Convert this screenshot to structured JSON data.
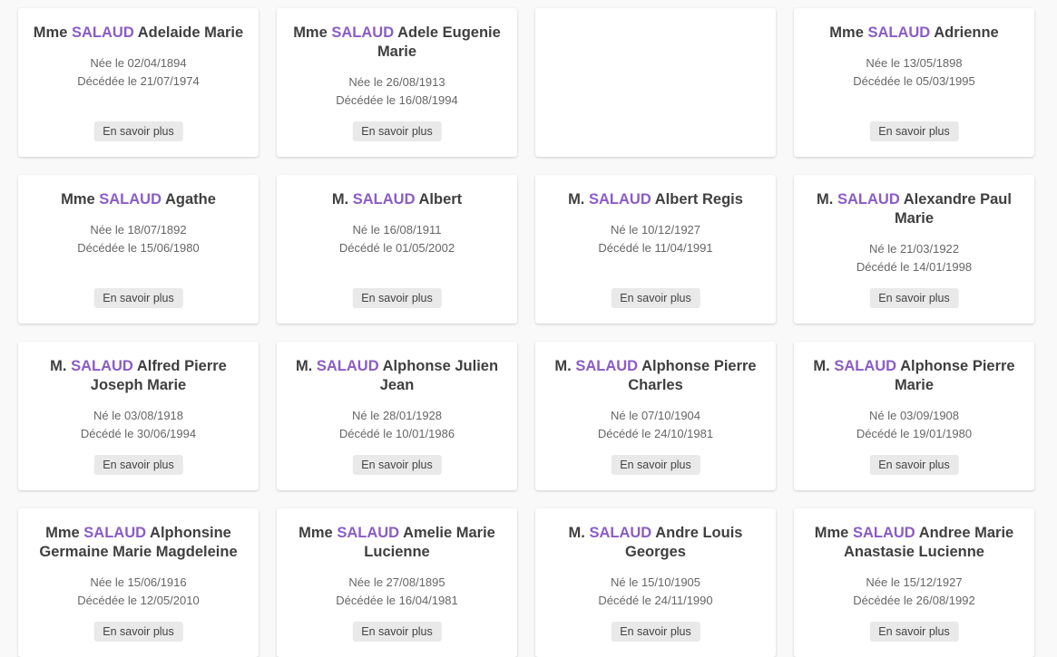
{
  "cards": [
    {
      "title": "Mme",
      "surname": "SALAUD",
      "given": "Adelaide Marie",
      "born": "Née le 02/04/1894",
      "died": "Décédée le 21/07/1974",
      "button": "En savoir plus"
    },
    {
      "title": "Mme",
      "surname": "SALAUD",
      "given": "Adele Eugenie Marie",
      "born": "Née le 26/08/1913",
      "died": "Décédée le 16/08/1994",
      "button": "En savoir plus"
    },
    {
      "empty": true
    },
    {
      "title": "Mme",
      "surname": "SALAUD",
      "given": "Adrienne",
      "born": "Née le 13/05/1898",
      "died": "Décédée le 05/03/1995",
      "button": "En savoir plus"
    },
    {
      "title": "Mme",
      "surname": "SALAUD",
      "given": "Agathe",
      "born": "Née le 18/07/1892",
      "died": "Décédée le 15/06/1980",
      "button": "En savoir plus"
    },
    {
      "title": "M.",
      "surname": "SALAUD",
      "given": "Albert",
      "born": "Né le 16/08/1911",
      "died": "Décédé le 01/05/2002",
      "button": "En savoir plus"
    },
    {
      "title": "M.",
      "surname": "SALAUD",
      "given": "Albert Regis",
      "born": "Né le 10/12/1927",
      "died": "Décédé le 11/04/1991",
      "button": "En savoir plus"
    },
    {
      "title": "M.",
      "surname": "SALAUD",
      "given": "Alexandre Paul Marie",
      "born": "Né le 21/03/1922",
      "died": "Décédé le 14/01/1998",
      "button": "En savoir plus"
    },
    {
      "title": "M.",
      "surname": "SALAUD",
      "given": "Alfred Pierre Joseph Marie",
      "born": "Né le 03/08/1918",
      "died": "Décédé le 30/06/1994",
      "button": "En savoir plus"
    },
    {
      "title": "M.",
      "surname": "SALAUD",
      "given": "Alphonse Julien Jean",
      "born": "Né le 28/01/1928",
      "died": "Décédé le 10/01/1986",
      "button": "En savoir plus"
    },
    {
      "title": "M.",
      "surname": "SALAUD",
      "given": "Alphonse Pierre Charles",
      "born": "Né le 07/10/1904",
      "died": "Décédé le 24/10/1981",
      "button": "En savoir plus"
    },
    {
      "title": "M.",
      "surname": "SALAUD",
      "given": "Alphonse Pierre Marie",
      "born": "Né le 03/09/1908",
      "died": "Décédé le 19/01/1980",
      "button": "En savoir plus"
    },
    {
      "title": "Mme",
      "surname": "SALAUD",
      "given": "Alphonsine Germaine Marie Magdeleine",
      "born": "Née le 15/06/1916",
      "died": "Décédée le 12/05/2010",
      "button": "En savoir plus"
    },
    {
      "title": "Mme",
      "surname": "SALAUD",
      "given": "Amelie Marie Lucienne",
      "born": "Née le 27/08/1895",
      "died": "Décédée le 16/04/1981",
      "button": "En savoir plus"
    },
    {
      "title": "M.",
      "surname": "SALAUD",
      "given": "Andre Louis Georges",
      "born": "Né le 15/10/1905",
      "died": "Décédé le 24/11/1990",
      "button": "En savoir plus"
    },
    {
      "title": "Mme",
      "surname": "SALAUD",
      "given": "Andree Marie Anastasie Lucienne",
      "born": "Née le 15/12/1927",
      "died": "Décédée le 26/08/1992",
      "button": "En savoir plus"
    }
  ],
  "colors": {
    "surname_accent": "#8b5cc5",
    "page_background": "#f9f9f9",
    "button_background": "#e9e9e9"
  }
}
